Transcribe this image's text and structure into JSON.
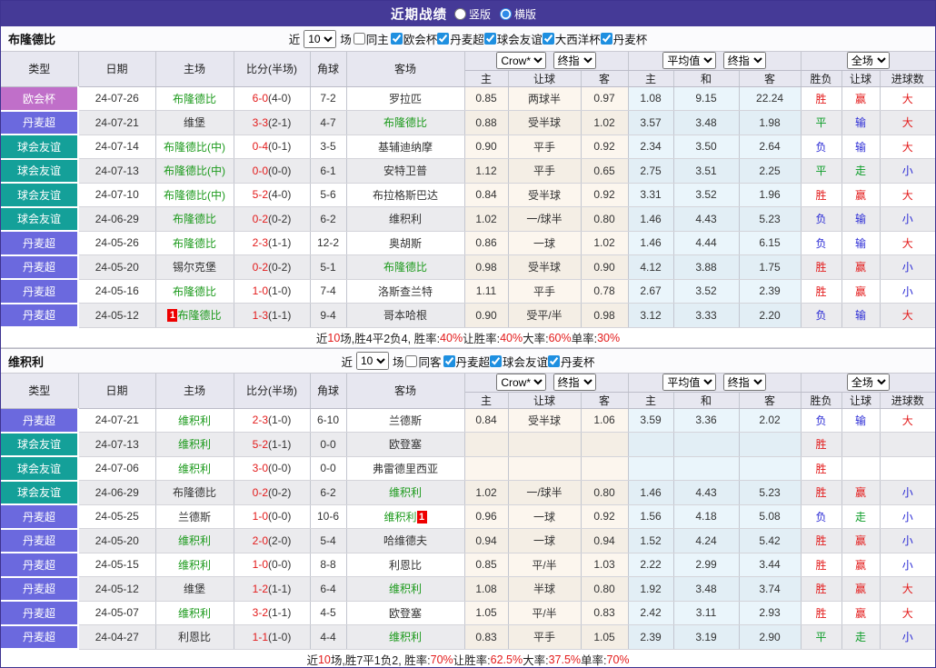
{
  "title_bar": {
    "title": "近期战绩",
    "radios": [
      {
        "label": "竖版",
        "checked": false
      },
      {
        "label": "横版",
        "checked": true
      }
    ]
  },
  "table": {
    "left_headers": [
      "类型",
      "日期",
      "主场",
      "比分(半场)",
      "角球",
      "客场"
    ],
    "sub_headers": [
      "主",
      "让球",
      "客",
      "主",
      "和",
      "客",
      "胜负",
      "让球",
      "进球数"
    ],
    "selects": {
      "handicap_company": "Crow*",
      "handicap_time": "终指",
      "average_label": "平均值",
      "average_time": "终指",
      "result_scope": "全场"
    }
  },
  "type_colors": {
    "欧会杯": "#c06fc9",
    "丹麦超": "#6b69de",
    "球会友谊": "#14a099"
  },
  "sections": [
    {
      "team": "布隆德比",
      "filter": {
        "near_label": "近",
        "count": "10",
        "matches_label": "场",
        "same_label": "同主",
        "same_checked": false,
        "leagues": [
          {
            "label": "欧会杯",
            "checked": true
          },
          {
            "label": "丹麦超",
            "checked": true
          },
          {
            "label": "球会友谊",
            "checked": true
          },
          {
            "label": "大西洋杯",
            "checked": true
          },
          {
            "label": "丹麦杯",
            "checked": true
          }
        ]
      },
      "rows": [
        {
          "type": "欧会杯",
          "date": "24-07-26",
          "home": "布隆德比",
          "hg": true,
          "score": "6-0",
          "half": "(4-0)",
          "corner": "7-2",
          "away": "罗拉匹",
          "odds": [
            "0.85",
            "两球半",
            "0.97"
          ],
          "avg": [
            "1.08",
            "9.15",
            "22.24"
          ],
          "res": [
            [
              "胜",
              "r"
            ],
            [
              "赢",
              "r"
            ],
            [
              "大",
              "r"
            ]
          ]
        },
        {
          "type": "丹麦超",
          "date": "24-07-21",
          "home": "维堡",
          "score": "3-3",
          "half": "(2-1)",
          "corner": "4-7",
          "away": "布隆德比",
          "ag": true,
          "odds": [
            "0.88",
            "受半球",
            "1.02"
          ],
          "avg": [
            "3.57",
            "3.48",
            "1.98"
          ],
          "res": [
            [
              "平",
              "g"
            ],
            [
              "输",
              "b"
            ],
            [
              "大",
              "r"
            ]
          ]
        },
        {
          "type": "球会友谊",
          "date": "24-07-14",
          "home": "布隆德比(中)",
          "hg": true,
          "score": "0-4",
          "half": "(0-1)",
          "corner": "3-5",
          "away": "基辅迪纳摩",
          "odds": [
            "0.90",
            "平手",
            "0.92"
          ],
          "avg": [
            "2.34",
            "3.50",
            "2.64"
          ],
          "res": [
            [
              "负",
              "b"
            ],
            [
              "输",
              "b"
            ],
            [
              "大",
              "r"
            ]
          ]
        },
        {
          "type": "球会友谊",
          "date": "24-07-13",
          "home": "布隆德比(中)",
          "hg": true,
          "score": "0-0",
          "half": "(0-0)",
          "corner": "6-1",
          "away": "安特卫普",
          "odds": [
            "1.12",
            "平手",
            "0.65"
          ],
          "avg": [
            "2.75",
            "3.51",
            "2.25"
          ],
          "res": [
            [
              "平",
              "g"
            ],
            [
              "走",
              "g"
            ],
            [
              "小",
              "b"
            ]
          ]
        },
        {
          "type": "球会友谊",
          "date": "24-07-10",
          "home": "布隆德比(中)",
          "hg": true,
          "score": "5-2",
          "half": "(4-0)",
          "corner": "5-6",
          "away": "布拉格斯巴达",
          "odds": [
            "0.84",
            "受半球",
            "0.92"
          ],
          "avg": [
            "3.31",
            "3.52",
            "1.96"
          ],
          "res": [
            [
              "胜",
              "r"
            ],
            [
              "赢",
              "r"
            ],
            [
              "大",
              "r"
            ]
          ]
        },
        {
          "type": "球会友谊",
          "date": "24-06-29",
          "home": "布隆德比",
          "hg": true,
          "score": "0-2",
          "half": "(0-2)",
          "corner": "6-2",
          "away": "维积利",
          "odds": [
            "1.02",
            "一/球半",
            "0.80"
          ],
          "avg": [
            "1.46",
            "4.43",
            "5.23"
          ],
          "res": [
            [
              "负",
              "b"
            ],
            [
              "输",
              "b"
            ],
            [
              "小",
              "b"
            ]
          ]
        },
        {
          "type": "丹麦超",
          "date": "24-05-26",
          "home": "布隆德比",
          "hg": true,
          "score": "2-3",
          "half": "(1-1)",
          "corner": "12-2",
          "away": "奥胡斯",
          "odds": [
            "0.86",
            "一球",
            "1.02"
          ],
          "avg": [
            "1.46",
            "4.44",
            "6.15"
          ],
          "res": [
            [
              "负",
              "b"
            ],
            [
              "输",
              "b"
            ],
            [
              "大",
              "r"
            ]
          ]
        },
        {
          "type": "丹麦超",
          "date": "24-05-20",
          "home": "锡尔克堡",
          "score": "0-2",
          "half": "(0-2)",
          "corner": "5-1",
          "away": "布隆德比",
          "ag": true,
          "odds": [
            "0.98",
            "受半球",
            "0.90"
          ],
          "avg": [
            "4.12",
            "3.88",
            "1.75"
          ],
          "res": [
            [
              "胜",
              "r"
            ],
            [
              "赢",
              "r"
            ],
            [
              "小",
              "b"
            ]
          ]
        },
        {
          "type": "丹麦超",
          "date": "24-05-16",
          "home": "布隆德比",
          "hg": true,
          "score": "1-0",
          "half": "(1-0)",
          "corner": "7-4",
          "away": "洛斯查兰特",
          "odds": [
            "1.11",
            "平手",
            "0.78"
          ],
          "avg": [
            "2.67",
            "3.52",
            "2.39"
          ],
          "res": [
            [
              "胜",
              "r"
            ],
            [
              "赢",
              "r"
            ],
            [
              "小",
              "b"
            ]
          ]
        },
        {
          "type": "丹麦超",
          "date": "24-05-12",
          "home": "布隆德比",
          "hg": true,
          "hc": "1",
          "score": "1-3",
          "half": "(1-1)",
          "corner": "9-4",
          "away": "哥本哈根",
          "odds": [
            "0.90",
            "受平/半",
            "0.98"
          ],
          "avg": [
            "3.12",
            "3.33",
            "2.20"
          ],
          "res": [
            [
              "负",
              "b"
            ],
            [
              "输",
              "b"
            ],
            [
              "大",
              "r"
            ]
          ]
        }
      ],
      "summary": [
        {
          "t": "近",
          "red": false
        },
        {
          "t": "10",
          "red": true
        },
        {
          "t": "场,胜4平2负4, 胜率:",
          "red": false
        },
        {
          "t": "40%",
          "red": true
        },
        {
          "t": " 让胜率:",
          "red": false
        },
        {
          "t": "40%",
          "red": true
        },
        {
          "t": " 大率:",
          "red": false
        },
        {
          "t": "60%",
          "red": true
        },
        {
          "t": " 单率:",
          "red": false
        },
        {
          "t": "30%",
          "red": true
        }
      ]
    },
    {
      "team": "维积利",
      "filter": {
        "near_label": "近",
        "count": "10",
        "matches_label": "场",
        "same_label": "同客",
        "same_checked": false,
        "leagues": [
          {
            "label": "丹麦超",
            "checked": true
          },
          {
            "label": "球会友谊",
            "checked": true
          },
          {
            "label": "丹麦杯",
            "checked": true
          }
        ]
      },
      "rows": [
        {
          "type": "丹麦超",
          "date": "24-07-21",
          "home": "维积利",
          "hg": true,
          "score": "2-3",
          "half": "(1-0)",
          "corner": "6-10",
          "away": "兰德斯",
          "odds": [
            "0.84",
            "受半球",
            "1.06"
          ],
          "avg": [
            "3.59",
            "3.36",
            "2.02"
          ],
          "res": [
            [
              "负",
              "b"
            ],
            [
              "输",
              "b"
            ],
            [
              "大",
              "r"
            ]
          ]
        },
        {
          "type": "球会友谊",
          "date": "24-07-13",
          "home": "维积利",
          "hg": true,
          "score": "5-2",
          "half": "(1-1)",
          "corner": "0-0",
          "away": "欧登塞",
          "odds": [
            "",
            "",
            ""
          ],
          "avg": [
            "",
            "",
            ""
          ],
          "res": [
            [
              "胜",
              "r"
            ],
            [
              "",
              ""
            ],
            [
              "",
              ""
            ]
          ]
        },
        {
          "type": "球会友谊",
          "date": "24-07-06",
          "home": "维积利",
          "hg": true,
          "score": "3-0",
          "half": "(0-0)",
          "corner": "0-0",
          "away": "弗雷德里西亚",
          "odds": [
            "",
            "",
            ""
          ],
          "avg": [
            "",
            "",
            ""
          ],
          "res": [
            [
              "胜",
              "r"
            ],
            [
              "",
              ""
            ],
            [
              "",
              ""
            ]
          ]
        },
        {
          "type": "球会友谊",
          "date": "24-06-29",
          "home": "布隆德比",
          "score": "0-2",
          "half": "(0-2)",
          "corner": "6-2",
          "away": "维积利",
          "ag": true,
          "odds": [
            "1.02",
            "一/球半",
            "0.80"
          ],
          "avg": [
            "1.46",
            "4.43",
            "5.23"
          ],
          "res": [
            [
              "胜",
              "r"
            ],
            [
              "赢",
              "r"
            ],
            [
              "小",
              "b"
            ]
          ]
        },
        {
          "type": "丹麦超",
          "date": "24-05-25",
          "home": "兰德斯",
          "score": "1-0",
          "half": "(0-0)",
          "corner": "10-6",
          "away": "维积利",
          "ag": true,
          "ac": "1",
          "odds": [
            "0.96",
            "一球",
            "0.92"
          ],
          "avg": [
            "1.56",
            "4.18",
            "5.08"
          ],
          "res": [
            [
              "负",
              "b"
            ],
            [
              "走",
              "g"
            ],
            [
              "小",
              "b"
            ]
          ]
        },
        {
          "type": "丹麦超",
          "date": "24-05-20",
          "home": "维积利",
          "hg": true,
          "score": "2-0",
          "half": "(2-0)",
          "corner": "5-4",
          "away": "哈维德夫",
          "odds": [
            "0.94",
            "一球",
            "0.94"
          ],
          "avg": [
            "1.52",
            "4.24",
            "5.42"
          ],
          "res": [
            [
              "胜",
              "r"
            ],
            [
              "赢",
              "r"
            ],
            [
              "小",
              "b"
            ]
          ]
        },
        {
          "type": "丹麦超",
          "date": "24-05-15",
          "home": "维积利",
          "hg": true,
          "score": "1-0",
          "half": "(0-0)",
          "corner": "8-8",
          "away": "利恩比",
          "odds": [
            "0.85",
            "平/半",
            "1.03"
          ],
          "avg": [
            "2.22",
            "2.99",
            "3.44"
          ],
          "res": [
            [
              "胜",
              "r"
            ],
            [
              "赢",
              "r"
            ],
            [
              "小",
              "b"
            ]
          ]
        },
        {
          "type": "丹麦超",
          "date": "24-05-12",
          "home": "维堡",
          "score": "1-2",
          "half": "(1-1)",
          "corner": "6-4",
          "away": "维积利",
          "ag": true,
          "odds": [
            "1.08",
            "半球",
            "0.80"
          ],
          "avg": [
            "1.92",
            "3.48",
            "3.74"
          ],
          "res": [
            [
              "胜",
              "r"
            ],
            [
              "赢",
              "r"
            ],
            [
              "大",
              "r"
            ]
          ]
        },
        {
          "type": "丹麦超",
          "date": "24-05-07",
          "home": "维积利",
          "hg": true,
          "score": "3-2",
          "half": "(1-1)",
          "corner": "4-5",
          "away": "欧登塞",
          "odds": [
            "1.05",
            "平/半",
            "0.83"
          ],
          "avg": [
            "2.42",
            "3.11",
            "2.93"
          ],
          "res": [
            [
              "胜",
              "r"
            ],
            [
              "赢",
              "r"
            ],
            [
              "大",
              "r"
            ]
          ]
        },
        {
          "type": "丹麦超",
          "date": "24-04-27",
          "home": "利恩比",
          "score": "1-1",
          "half": "(1-0)",
          "corner": "4-4",
          "away": "维积利",
          "ag": true,
          "odds": [
            "0.83",
            "平手",
            "1.05"
          ],
          "avg": [
            "2.39",
            "3.19",
            "2.90"
          ],
          "res": [
            [
              "平",
              "g"
            ],
            [
              "走",
              "g"
            ],
            [
              "小",
              "b"
            ]
          ]
        }
      ],
      "summary": [
        {
          "t": "近",
          "red": false
        },
        {
          "t": "10",
          "red": true
        },
        {
          "t": "场,胜7平1负2, 胜率:",
          "red": false
        },
        {
          "t": "70%",
          "red": true
        },
        {
          "t": " 让胜率:",
          "red": false
        },
        {
          "t": "62.5%",
          "red": true
        },
        {
          "t": " 大率:",
          "red": false
        },
        {
          "t": "37.5%",
          "red": true
        },
        {
          "t": " 单率:",
          "red": false
        },
        {
          "t": "70%",
          "red": true
        }
      ]
    }
  ]
}
